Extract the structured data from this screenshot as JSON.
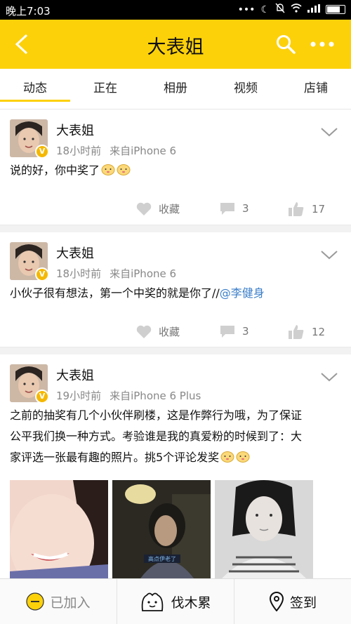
{
  "status_bar": {
    "time": "晚上7:03"
  },
  "header": {
    "title": "大表姐"
  },
  "tabs": [
    "动态",
    "正在",
    "相册",
    "视频",
    "店铺"
  ],
  "posts": [
    {
      "author": "大表姐",
      "time": "18小时前",
      "source": "来自iPhone 6",
      "text": "说的好，你中奖了",
      "favorite_label": "收藏",
      "comments": "3",
      "likes": "17"
    },
    {
      "author": "大表姐",
      "time": "18小时前",
      "source": "来自iPhone 6",
      "text": "小伙子很有想法，第一个中奖的就是你了//",
      "mention": "@李健身",
      "favorite_label": "收藏",
      "comments": "3",
      "likes": "12"
    },
    {
      "author": "大表姐",
      "time": "19小时前",
      "source": "来自iPhone 6 Plus",
      "text_lines": [
        "之前的抽奖有几个小伙伴刷楼，这是作弊行为哦，为了保证",
        "公平我们换一种方式。考验谁是我的真爱粉的时候到了：大",
        "家评选一张最有趣的照片。挑5个评论发奖"
      ],
      "photo_caption": "高点伊老了"
    }
  ],
  "bottom_bar": {
    "joined": "已加入",
    "group": "伐木累",
    "checkin": "签到"
  },
  "colors": {
    "brand_yellow": "#fdd10a",
    "mention_blue": "#3a7ec9"
  }
}
